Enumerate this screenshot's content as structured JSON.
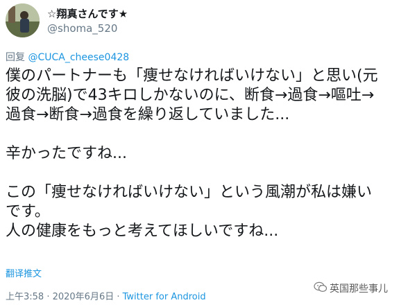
{
  "user": {
    "name": "☆翔真さんです★",
    "handle": "@shoma_520"
  },
  "reply": {
    "prefix": "回复 ",
    "mention": "@CUCA_cheese0428"
  },
  "tweet": {
    "lines": [
      "僕のパートナーも「痩せなければいけない」と思い(元",
      "彼の洗脳)で43キロしかないのに、断食→過食→嘔吐→",
      "過食→断食→過食を繰り返していました...",
      "",
      "辛かったですね...",
      "",
      "この「痩せなければいけない」という風潮が私は嫌い",
      "です。",
      "人の健康をもっと考えてほしいですね..."
    ]
  },
  "translate_label": "翻译推文",
  "meta": {
    "time_date": "上午3:58 · 2020年6月6日 · ",
    "source": "Twitter for Android"
  },
  "watermark": {
    "icon": "wechat-icon",
    "text": "英国那些事儿"
  }
}
